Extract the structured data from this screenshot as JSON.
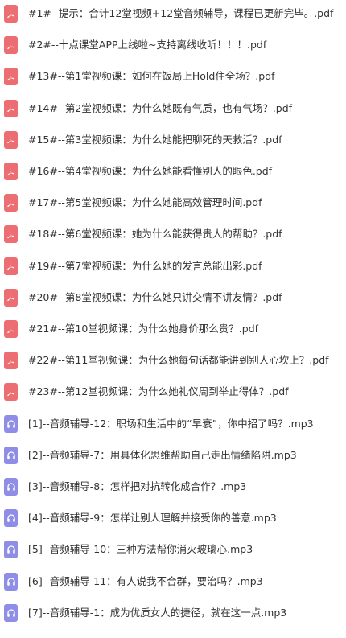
{
  "files": [
    {
      "name": "#1#--提示：合计12堂视频+12堂音频辅导，课程已更新完毕。.pdf",
      "type": "pdf",
      "icon": "pdf-icon"
    },
    {
      "name": "#2#--十点课堂APP上线啦~支持离线收听！！！.pdf",
      "type": "pdf",
      "icon": "pdf-icon"
    },
    {
      "name": "#13#--第1堂视频课：如何在饭局上Hold住全场？.pdf",
      "type": "pdf",
      "icon": "pdf-icon"
    },
    {
      "name": "#14#--第2堂视频课：为什么她既有气质，也有气场？.pdf",
      "type": "pdf",
      "icon": "pdf-icon"
    },
    {
      "name": "#15#--第3堂视频课：为什么她能把聊死的天救活？.pdf",
      "type": "pdf",
      "icon": "pdf-icon"
    },
    {
      "name": "#16#--第4堂视频课：为什么她能看懂别人的眼色.pdf",
      "type": "pdf",
      "icon": "pdf-icon"
    },
    {
      "name": "#17#--第5堂视频课：为什么她能高效管理时间.pdf",
      "type": "pdf",
      "icon": "pdf-icon"
    },
    {
      "name": "#18#--第6堂视频课：她为什么能获得贵人的帮助？.pdf",
      "type": "pdf",
      "icon": "pdf-icon"
    },
    {
      "name": "#19#--第7堂视频课：为什么她的发言总能出彩.pdf",
      "type": "pdf",
      "icon": "pdf-icon"
    },
    {
      "name": "#20#--第8堂视频课：为什么她只讲交情不讲友情？.pdf",
      "type": "pdf",
      "icon": "pdf-icon"
    },
    {
      "name": "#21#--第10堂视频课：为什么她身价那么贵？.pdf",
      "type": "pdf",
      "icon": "pdf-icon"
    },
    {
      "name": "#22#--第11堂视频课：为什么她每句话都能讲到别人心坎上？.pdf",
      "type": "pdf",
      "icon": "pdf-icon"
    },
    {
      "name": "#23#--第12堂视频课：为什么她礼仪周到举止得体？.pdf",
      "type": "pdf",
      "icon": "pdf-icon"
    },
    {
      "name": "[1]--音频辅导-12：职场和生活中的“早衰”，你中招了吗？.mp3",
      "type": "audio",
      "icon": "headphones-icon"
    },
    {
      "name": "[2]--音频辅导-7：用具体化思维帮助自己走出情绪陷阱.mp3",
      "type": "audio",
      "icon": "headphones-icon"
    },
    {
      "name": "[3]--音频辅导-8：怎样把对抗转化成合作？.mp3",
      "type": "audio",
      "icon": "headphones-icon"
    },
    {
      "name": "[4]--音频辅导-9：怎样让别人理解并接受你的善意.mp3",
      "type": "audio",
      "icon": "headphones-icon"
    },
    {
      "name": "[5]--音频辅导-10：三种方法帮你消灭玻璃心.mp3",
      "type": "audio",
      "icon": "headphones-icon"
    },
    {
      "name": "[6]--音频辅导-11：有人说我不合群，要治吗？.mp3",
      "type": "audio",
      "icon": "headphones-icon"
    },
    {
      "name": "[7]--音频辅导-1：成为优质女人的捷径，就在这一点.mp3",
      "type": "audio",
      "icon": "headphones-icon"
    }
  ],
  "colors": {
    "pdf_icon": "#ec6d72",
    "audio_icon": "#8f8ee6",
    "text": "#333333"
  }
}
